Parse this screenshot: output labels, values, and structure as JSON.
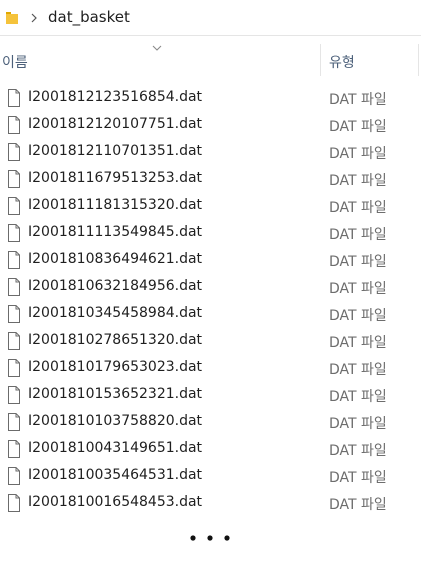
{
  "address_bar": {
    "folder_icon": "folder-icon",
    "separator_icon": "chevron-right-icon",
    "path": "dat_basket"
  },
  "columns": {
    "name": "이름",
    "type": "유형",
    "sort_icon": "chevron-down-icon"
  },
  "files": [
    {
      "name": "I2001812123516854.dat",
      "type": "DAT 파일"
    },
    {
      "name": "I2001812120107751.dat",
      "type": "DAT 파일"
    },
    {
      "name": "I2001812110701351.dat",
      "type": "DAT 파일"
    },
    {
      "name": "I2001811679513253.dat",
      "type": "DAT 파일"
    },
    {
      "name": "I2001811181315320.dat",
      "type": "DAT 파일"
    },
    {
      "name": "I2001811113549845.dat",
      "type": "DAT 파일"
    },
    {
      "name": "I2001810836494621.dat",
      "type": "DAT 파일"
    },
    {
      "name": "I2001810632184956.dat",
      "type": "DAT 파일"
    },
    {
      "name": "I2001810345458984.dat",
      "type": "DAT 파일"
    },
    {
      "name": "I2001810278651320.dat",
      "type": "DAT 파일"
    },
    {
      "name": "I2001810179653023.dat",
      "type": "DAT 파일"
    },
    {
      "name": "I2001810153652321.dat",
      "type": "DAT 파일"
    },
    {
      "name": "I2001810103758820.dat",
      "type": "DAT 파일"
    },
    {
      "name": "I2001810043149651.dat",
      "type": "DAT 파일"
    },
    {
      "name": "I2001810035464531.dat",
      "type": "DAT 파일"
    },
    {
      "name": "I2001810016548453.dat",
      "type": "DAT 파일"
    }
  ],
  "more_indicator": "ellipsis-icon",
  "colors": {
    "folder": "#f5c33b",
    "header_text": "#4c607a",
    "type_text": "#6d6d6d"
  }
}
